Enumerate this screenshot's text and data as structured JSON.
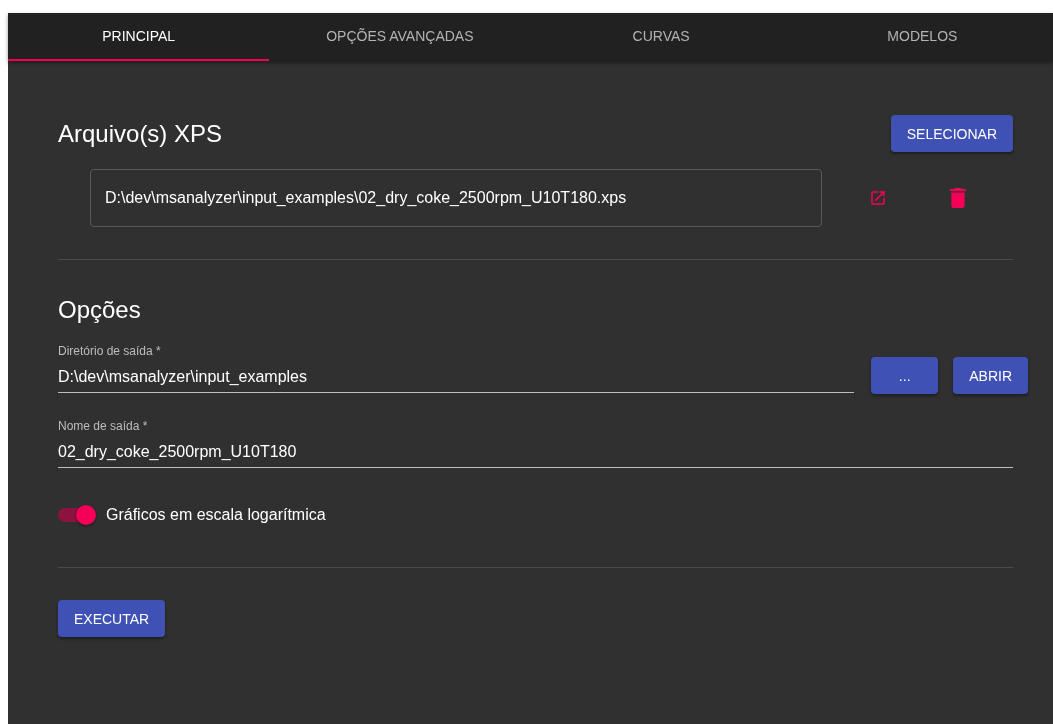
{
  "tabs": [
    {
      "label": "PRINCIPAL",
      "selected": true
    },
    {
      "label": "OPÇÕES AVANÇADAS",
      "selected": false
    },
    {
      "label": "CURVAS",
      "selected": false
    },
    {
      "label": "MODELOS",
      "selected": false
    }
  ],
  "files_section": {
    "title": "Arquivo(s) XPS",
    "button": "SELECIONAR",
    "files": [
      {
        "path": "D:\\dev\\msanalyzer\\input_examples\\02_dry_coke_2500rpm_U10T180.xps"
      }
    ]
  },
  "options_section": {
    "title": "Opções",
    "output_dir": {
      "label": "Diretório de saída *",
      "value": "D:\\dev\\msanalyzer\\input_examples"
    },
    "browse_button": "...",
    "open_button": "ABRIR",
    "output_name": {
      "label": "Nome de saída *",
      "value": "02_dry_coke_2500rpm_U10T180"
    },
    "log_scale": {
      "label": "Gráficos em escala logarítmica",
      "on": true
    }
  },
  "run_button": "EXECUTAR"
}
